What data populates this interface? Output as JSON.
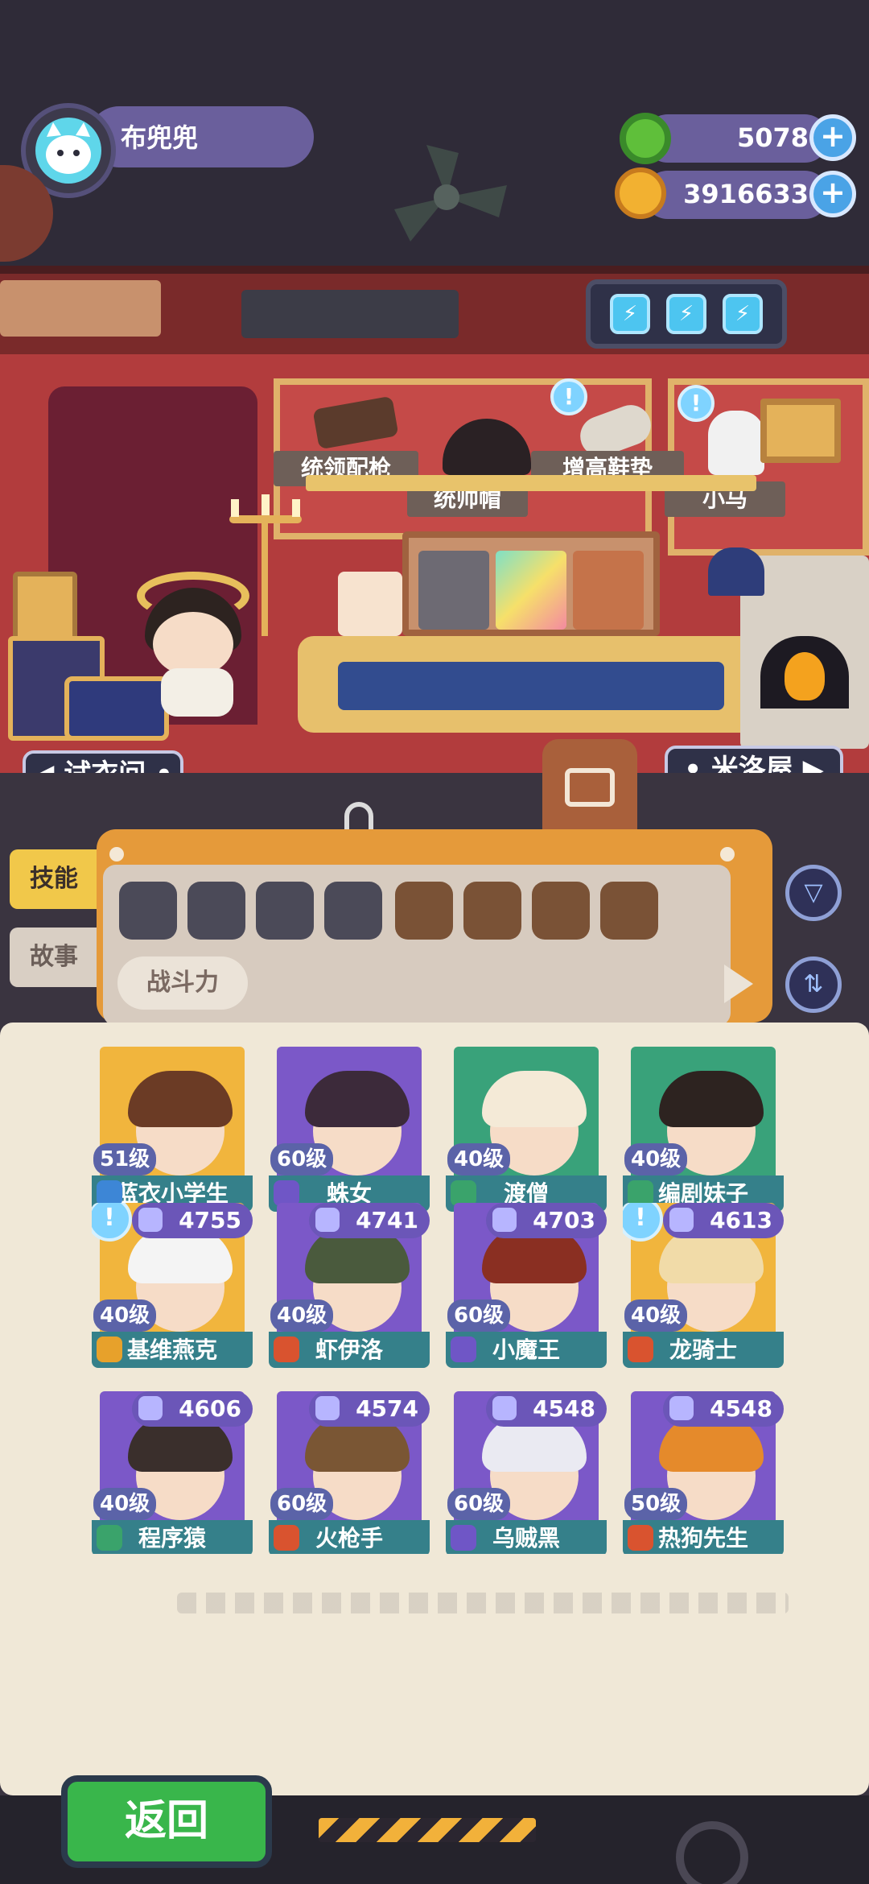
{
  "player": {
    "name": "布兜兜"
  },
  "currency": {
    "gems": {
      "value": "5078",
      "icon": "green-donut-icon"
    },
    "coins": {
      "value": "3916633",
      "icon": "gold-planet-coin-icon"
    }
  },
  "room": {
    "items": [
      {
        "label": "统领配枪",
        "icon": "pistol-icon"
      },
      {
        "label": "统帅帽",
        "icon": "bicorne-hat-icon"
      },
      {
        "label": "增高鞋垫",
        "icon": "insole-icon"
      },
      {
        "label": "小马",
        "icon": "horse-icon"
      }
    ],
    "nav_left": "试衣间",
    "nav_right": "米洛屋"
  },
  "side_tabs": {
    "skills": "技能",
    "story": "故事"
  },
  "filter_panel": {
    "power_label": "战斗力"
  },
  "characters": [
    {
      "level": "51级",
      "name": "蓝衣小学生",
      "power": "",
      "color": "#f1b53d",
      "hair": "#6b3b25",
      "shield_color": "#3d86d6"
    },
    {
      "level": "60级",
      "name": "蛛女",
      "power": "",
      "color": "#7b58c8",
      "hair": "#3c2a3a",
      "shield_color": "#6f56c6"
    },
    {
      "level": "40级",
      "name": "渡僧",
      "power": "",
      "color": "#39a27a",
      "hair": "#f4ead7",
      "shield_color": "#3aa36b"
    },
    {
      "level": "40级",
      "name": "编剧妹子",
      "power": "",
      "color": "#39a27a",
      "hair": "#2d2320",
      "shield_color": "#3aa36b"
    },
    {
      "level": "40级",
      "name": "基维燕克",
      "power": "4755",
      "color": "#f1b53d",
      "hair": "#f4f4f4",
      "shield_color": "#e7a12b",
      "alert": true
    },
    {
      "level": "40级",
      "name": "虾伊洛",
      "power": "4741",
      "color": "#7b58c8",
      "hair": "#4a5a3d",
      "shield_color": "#d9532f"
    },
    {
      "level": "60级",
      "name": "小魔王",
      "power": "4703",
      "color": "#7b58c8",
      "hair": "#8a2f22",
      "shield_color": "#6f56c6"
    },
    {
      "level": "40级",
      "name": "龙骑士",
      "power": "4613",
      "color": "#f1b53d",
      "hair": "#f1dba8",
      "shield_color": "#d9532f",
      "alert": true
    },
    {
      "level": "40级",
      "name": "程序猿",
      "power": "4606",
      "color": "#7b58c8",
      "hair": "#3a2f2c",
      "shield_color": "#3aa36b"
    },
    {
      "level": "60级",
      "name": "火枪手",
      "power": "4574",
      "color": "#7b58c8",
      "hair": "#7a5634",
      "shield_color": "#d9532f"
    },
    {
      "level": "60级",
      "name": "乌贼黑",
      "power": "4548",
      "color": "#7b58c8",
      "hair": "#eaeaf2",
      "shield_color": "#6f56c6"
    },
    {
      "level": "50级",
      "name": "热狗先生",
      "power": "4548",
      "color": "#7b58c8",
      "hair": "#e58a2b",
      "shield_color": "#d9532f"
    }
  ],
  "buttons": {
    "back": "返回"
  },
  "colors": {
    "accent_purple": "#6a5f9c",
    "accent_green": "#39b64b",
    "room_red": "#b23c3d"
  }
}
